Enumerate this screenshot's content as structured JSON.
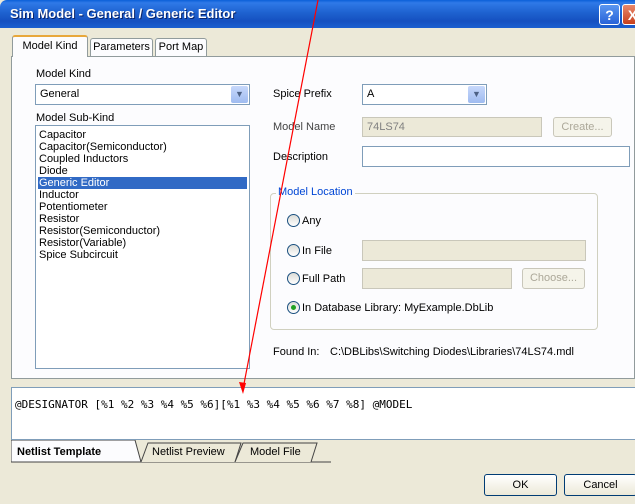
{
  "window": {
    "title": "Sim Model - General / Generic Editor",
    "help_label": "?",
    "close_label": "X"
  },
  "tabs": [
    {
      "label": "Model Kind"
    },
    {
      "label": "Parameters"
    },
    {
      "label": "Port Map"
    }
  ],
  "model_kind": {
    "label": "Model Kind",
    "value": "General",
    "subkind_label": "Model Sub-Kind",
    "subkinds": [
      "Capacitor",
      "Capacitor(Semiconductor)",
      "Coupled Inductors",
      "Diode",
      "Generic Editor",
      "Inductor",
      "Potentiometer",
      "Resistor",
      "Resistor(Semiconductor)",
      "Resistor(Variable)",
      "Spice Subcircuit"
    ],
    "selected_subkind": "Generic Editor"
  },
  "spice_prefix": {
    "label": "Spice Prefix",
    "value": "A"
  },
  "model_name": {
    "label": "Model Name",
    "value": "74LS74",
    "create_label": "Create..."
  },
  "description": {
    "label": "Description",
    "value": ""
  },
  "model_location": {
    "legend": "Model Location",
    "any_label": "Any",
    "in_file_label": "In File",
    "full_path_label": "Full Path",
    "choose_label": "Choose...",
    "db_label": "In Database Library: MyExample.DbLib",
    "selected": "database"
  },
  "found_in": {
    "label": "Found In:",
    "value": "C:\\DBLibs\\Switching Diodes\\Libraries\\74LS74.mdl"
  },
  "netlist_template": "@DESIGNATOR [%1 %2 %3 %4 %5 %6][%1 %3 %4 %5 %6 %7 %8] @MODEL",
  "bottom_tabs": [
    {
      "label": "Netlist Template"
    },
    {
      "label": "Netlist Preview"
    },
    {
      "label": "Model File"
    }
  ],
  "buttons": {
    "ok": "OK",
    "cancel": "Cancel"
  },
  "colors": {
    "annotation_arrow": "#ff0000",
    "selection": "#316ac5",
    "titlebar": "#0a5fd8"
  }
}
